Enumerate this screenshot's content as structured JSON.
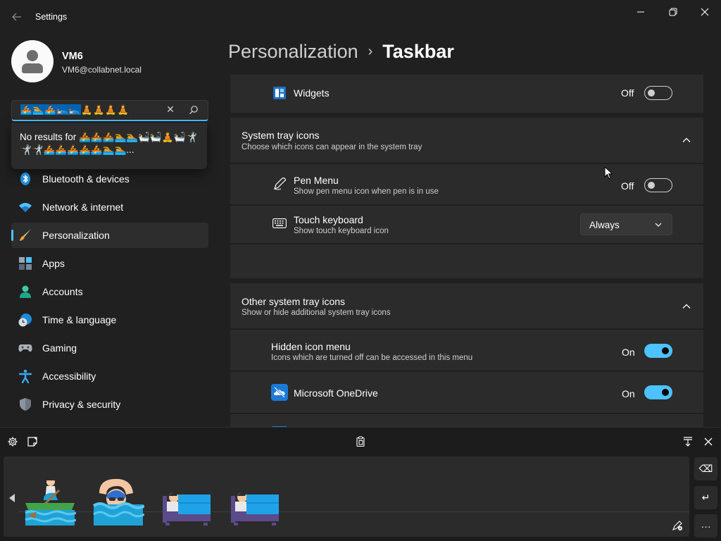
{
  "window": {
    "title": "Settings"
  },
  "user": {
    "name": "VM6",
    "email": "VM6@collabnet.local"
  },
  "search": {
    "query_selected": "🚣🏊🚣🛌🛌",
    "query_rest": "🧘🧘🧘🧘",
    "results_prefix": "No results for ",
    "results_emojis": "🚣🚣🚣🏊🏊🛀🛀🧘🛀🤺🤺🤺🚣🚣🚣🚣🚣🏊🏊...",
    "clear_glyph": "✕"
  },
  "nav": {
    "items": [
      {
        "label": "Bluetooth & devices",
        "icon": "bluetooth-icon"
      },
      {
        "label": "Network & internet",
        "icon": "wifi-icon"
      },
      {
        "label": "Personalization",
        "icon": "brush-icon",
        "active": true
      },
      {
        "label": "Apps",
        "icon": "apps-icon"
      },
      {
        "label": "Accounts",
        "icon": "account-icon"
      },
      {
        "label": "Time & language",
        "icon": "globe-clock-icon"
      },
      {
        "label": "Gaming",
        "icon": "gamepad-icon"
      },
      {
        "label": "Accessibility",
        "icon": "accessibility-icon"
      },
      {
        "label": "Privacy & security",
        "icon": "shield-icon"
      }
    ]
  },
  "breadcrumb": {
    "parent": "Personalization",
    "separator": "›",
    "current": "Taskbar"
  },
  "widgets": {
    "label": "Widgets",
    "state": "Off",
    "on": false
  },
  "system_tray": {
    "title": "System tray icons",
    "subtitle": "Choose which icons can appear in the system tray",
    "pen_menu": {
      "label": "Pen Menu",
      "sub": "Show pen menu icon when pen is in use",
      "state": "Off",
      "on": false
    },
    "touch_keyboard": {
      "label": "Touch keyboard",
      "sub": "Show touch keyboard icon",
      "value": "Always"
    }
  },
  "other_tray": {
    "title": "Other system tray icons",
    "subtitle": "Show or hide additional system tray icons",
    "hidden_menu": {
      "label": "Hidden icon menu",
      "sub": "Icons which are turned off can be accessed in this menu",
      "state": "On",
      "on": true
    },
    "onedrive": {
      "label": "Microsoft OneDrive",
      "state": "On",
      "on": true
    }
  },
  "keyboard": {
    "emojis": [
      "person-rowing-boat",
      "person-swimming",
      "person-in-bed",
      "person-in-bed"
    ],
    "keys": {
      "backspace": "⌫",
      "enter": "↵",
      "more": "···"
    }
  },
  "colors": {
    "accent": "#4cc2ff",
    "background": "#202020",
    "card": "#2b2b2b"
  }
}
